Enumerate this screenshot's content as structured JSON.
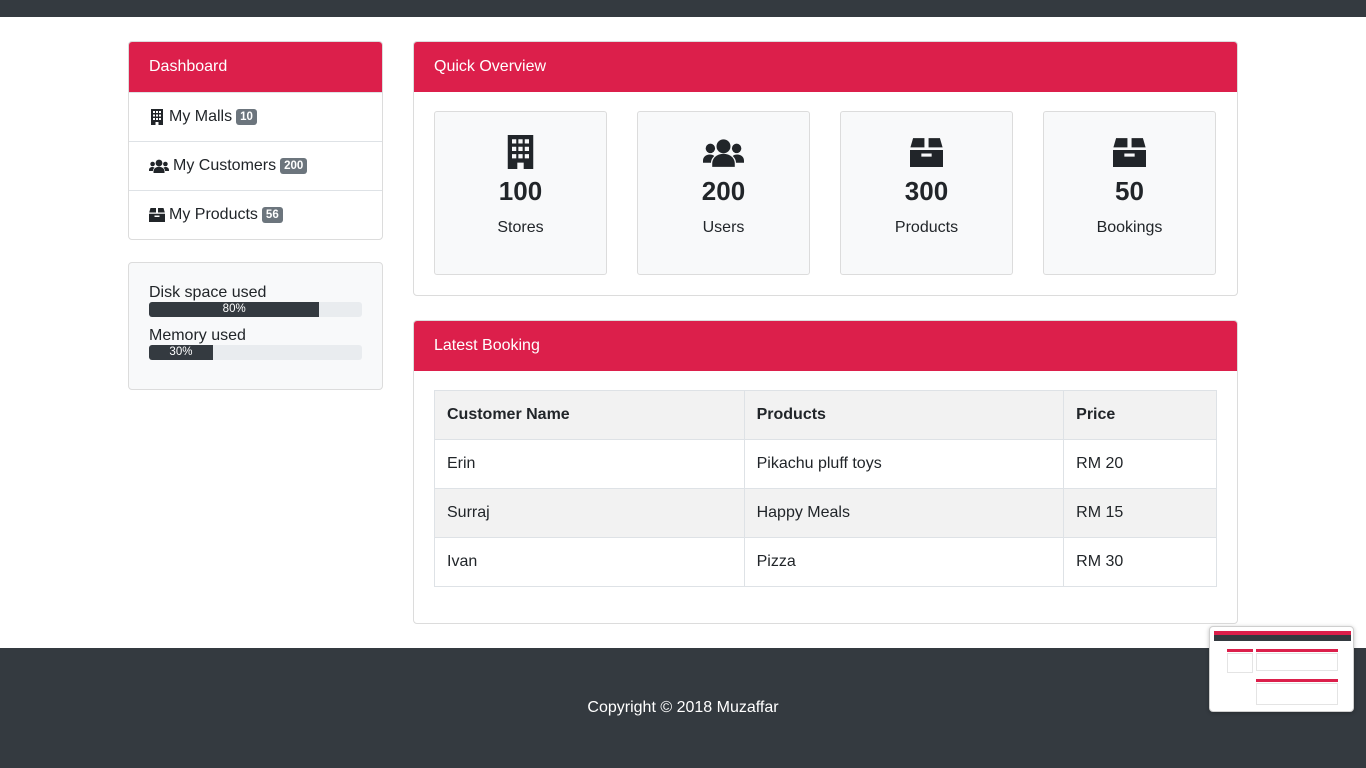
{
  "sidebar": {
    "title": "Dashboard",
    "items": [
      {
        "label": "My Malls",
        "badge": "10",
        "icon": "building-icon"
      },
      {
        "label": "My Customers",
        "badge": "200",
        "icon": "users-icon"
      },
      {
        "label": "My Products",
        "badge": "56",
        "icon": "box-icon"
      }
    ]
  },
  "usage": {
    "disk": {
      "label": "Disk space used",
      "value": "80%",
      "fraction": 0.8
    },
    "memory": {
      "label": "Memory used",
      "value": "30%",
      "fraction": 0.3
    }
  },
  "overview": {
    "title": "Quick Overview",
    "tiles": [
      {
        "value": "100",
        "label": "Stores",
        "icon": "building-icon"
      },
      {
        "value": "200",
        "label": "Users",
        "icon": "users-icon"
      },
      {
        "value": "300",
        "label": "Products",
        "icon": "box-icon"
      },
      {
        "value": "50",
        "label": "Bookings",
        "icon": "box-icon"
      }
    ]
  },
  "booking": {
    "title": "Latest Booking",
    "headers": [
      "Customer Name",
      "Products",
      "Price"
    ],
    "rows": [
      [
        "Erin",
        "Pikachu pluff toys",
        "RM 20"
      ],
      [
        "Surraj",
        "Happy Meals",
        "RM 15"
      ],
      [
        "Ivan",
        "Pizza",
        "RM 30"
      ]
    ]
  },
  "footer": {
    "copyright": "Copyright © 2018 Muzaffar"
  },
  "colors": {
    "accent": "#dc1f4b",
    "dark": "#343a40",
    "badge": "#6c757d"
  }
}
